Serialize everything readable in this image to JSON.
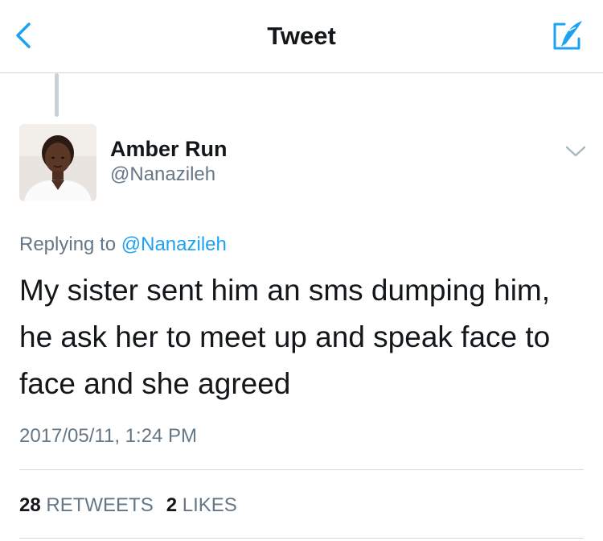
{
  "header": {
    "title": "Tweet",
    "back_icon": "chevron-left-icon",
    "compose_icon": "compose-tweet-icon"
  },
  "tweet": {
    "author_name": "Amber Run",
    "author_handle": "@Nanazileh",
    "replying_prefix": "Replying to",
    "replying_to": "@Nanazileh",
    "text": "My sister sent him an sms dumping him, he ask her to meet up and speak face to face and she agreed",
    "timestamp": "2017/05/11, 1:24 PM"
  },
  "stats": {
    "retweets_count": "28",
    "retweets_label": "RETWEETS",
    "likes_count": "2",
    "likes_label": "LIKES"
  },
  "colors": {
    "accent": "#1da1f2",
    "text_primary": "#14171a",
    "text_secondary": "#657786",
    "divider": "#d3d6da"
  }
}
